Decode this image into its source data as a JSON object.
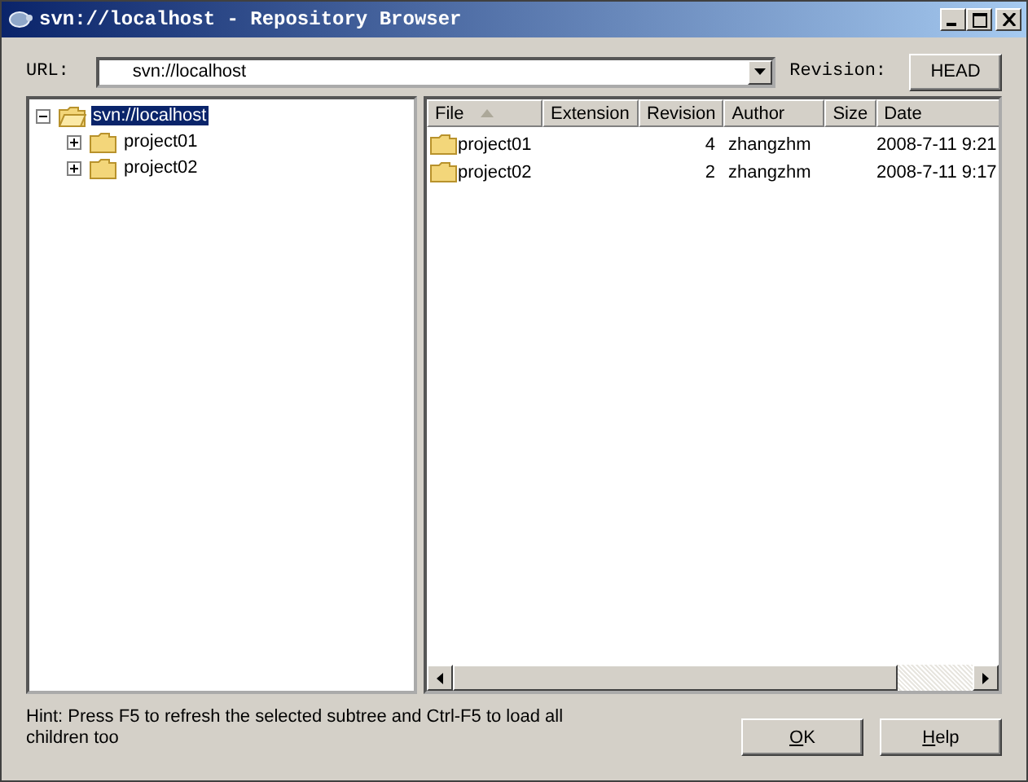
{
  "window": {
    "title": "svn://localhost - Repository Browser"
  },
  "url": {
    "label": "URL:",
    "value": "svn://localhost"
  },
  "revision": {
    "label": "Revision:",
    "button": "HEAD"
  },
  "tree": [
    {
      "label": "svn://localhost",
      "expanded": true,
      "selected": true,
      "children": [
        {
          "label": "project01",
          "expanded": false,
          "selected": false
        },
        {
          "label": "project02",
          "expanded": false,
          "selected": false
        }
      ]
    }
  ],
  "table": {
    "columns": [
      {
        "label": "File",
        "sorted": true
      },
      {
        "label": "Extension",
        "sorted": false
      },
      {
        "label": "Revision",
        "sorted": false
      },
      {
        "label": "Author",
        "sorted": false
      },
      {
        "label": "Size",
        "sorted": false
      },
      {
        "label": "Date",
        "sorted": false
      }
    ],
    "rows": [
      [
        "project01",
        "",
        "4",
        "zhangzhm",
        "",
        "2008-7-11 9:21"
      ],
      [
        "project02",
        "",
        "2",
        "zhangzhm",
        "",
        "2008-7-11 9:17"
      ]
    ]
  },
  "hint": "Hint: Press F5 to refresh the selected subtree and Ctrl-F5 to load all children too",
  "buttons": [
    "OK",
    "Help"
  ]
}
